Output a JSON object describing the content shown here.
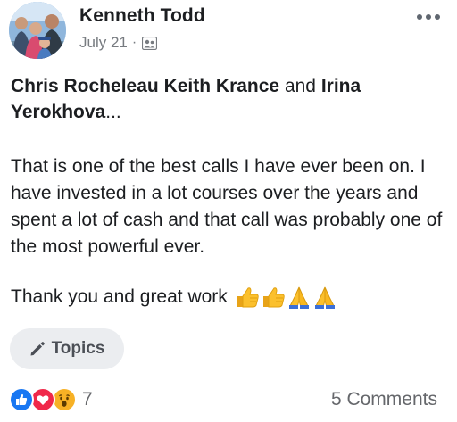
{
  "post": {
    "author": "Kenneth Todd",
    "date": "July 21",
    "separator": "·",
    "mentions": {
      "first": "Chris Rocheleau",
      "second": "Keith Krance",
      "joiner": "and",
      "third": "Irina Yerokhova",
      "ellipsis": "..."
    },
    "message": "That is one of the best calls I have ever been on.  I have invested in a lot courses over the years and spent a lot of cash and that call was probably one of the most powerful ever.",
    "thanks": "Thank you and great work",
    "emojis": [
      "thumbs-up",
      "thumbs-up",
      "folded-hands",
      "folded-hands"
    ]
  },
  "topics": {
    "label": "Topics",
    "icon": "pencil-icon"
  },
  "footer": {
    "reaction_icons": [
      "like-icon",
      "love-icon",
      "wow-icon"
    ],
    "reaction_count": "7",
    "comments": "5 Comments"
  },
  "colors": {
    "like": "#1877f2",
    "love": "#f0284a",
    "wow": "#f7b125",
    "text": "#1c1e21",
    "secondary": "#65676b",
    "button_bg": "#ebedf0"
  }
}
